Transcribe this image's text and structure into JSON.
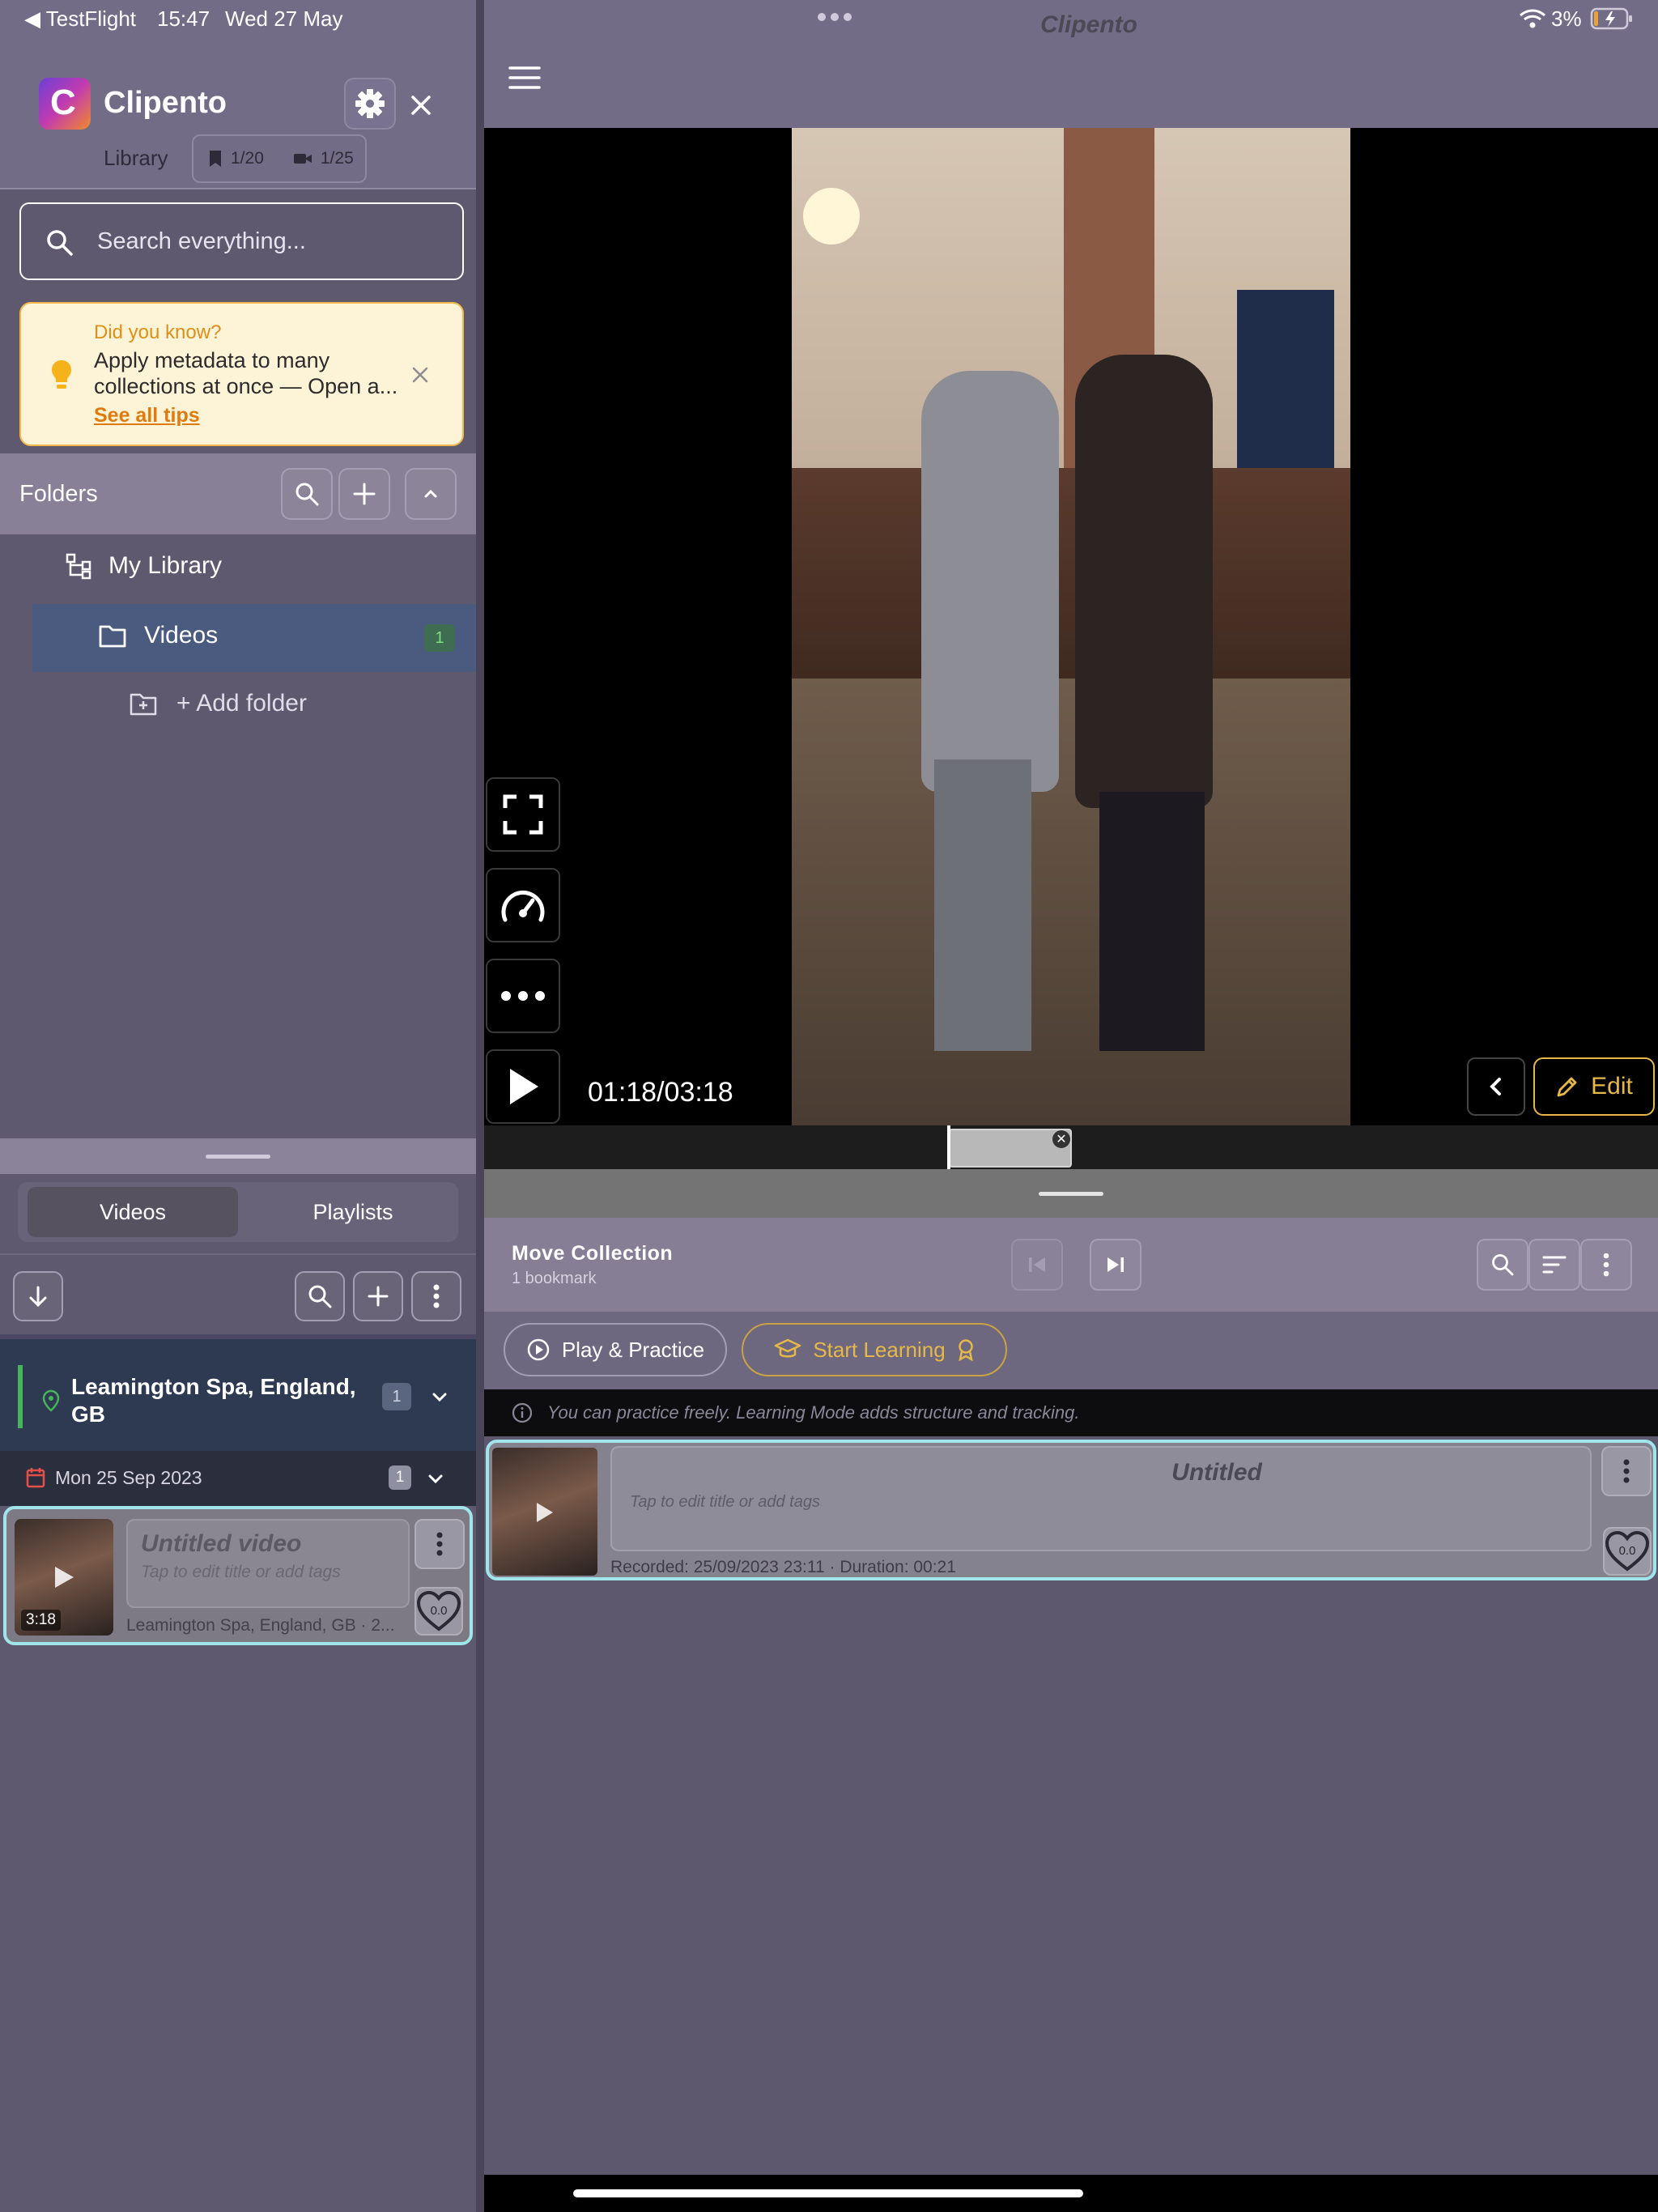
{
  "status_bar": {
    "back_app": "◀ TestFlight",
    "time": "15:47",
    "date": "Wed 27 May",
    "battery": "3%"
  },
  "sidebar": {
    "app_name": "Clipento",
    "library_label": "Library",
    "bookmark_count": "1/20",
    "video_count": "1/25",
    "search_placeholder": "Search everything...",
    "tip": {
      "title": "Did you know?",
      "body": "Apply metadata to many collections at once — Open a...",
      "link": "See all tips"
    },
    "folders_title": "Folders",
    "tree": {
      "root": "My Library",
      "videos": "Videos",
      "videos_count": "1",
      "add_folder": "+ Add folder"
    },
    "tabs": {
      "videos": "Videos",
      "playlists": "Playlists"
    },
    "group": {
      "title": "Leamington Spa, England, GB",
      "count": "1"
    },
    "date_group": {
      "label": "Mon 25 Sep 2023",
      "count": "1"
    },
    "video_item": {
      "title": "Untitled video",
      "subtitle": "Tap to edit title or add tags",
      "meta": "Leamington Spa, England, GB · 2...",
      "duration": "3:18",
      "rating": "0.0"
    }
  },
  "main": {
    "title": "Clipento",
    "time_display": "01:18/03:18",
    "edit_label": "Edit",
    "collection": {
      "title": "Move Collection",
      "subtitle": "1 bookmark"
    },
    "practice_label": "Play & Practice",
    "learning_label": "Start Learning",
    "info": "You can practice freely. Learning Mode adds structure and tracking.",
    "bookmark": {
      "title": "Untitled",
      "subtitle": "Tap to edit title or add tags",
      "meta": "Recorded: 25/09/2023 23:11 · Duration: 00:21",
      "rating": "0.0"
    }
  },
  "colors": {
    "accent_gold": "#e5b847",
    "selection_cyan": "#9fe5ea",
    "tip_orange": "#e08f16",
    "folder_selected": "#4b5b80"
  }
}
